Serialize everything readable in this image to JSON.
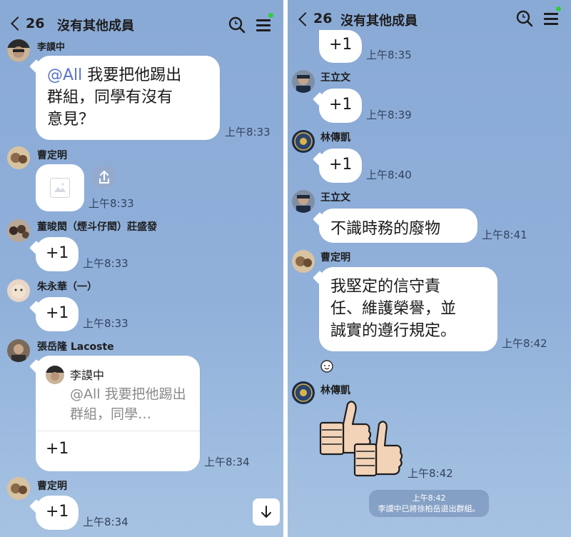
{
  "left_panel": {
    "header": {
      "member_count": "26",
      "title": "沒有其他成員"
    },
    "messages": [
      {
        "sender": "李謨中",
        "lines": [
          "@All 我要把他踢出",
          "群組，同學有沒有",
          "意見？"
        ],
        "mention": "@All",
        "time": "上午8:33"
      },
      {
        "sender": "曹定明",
        "type": "image",
        "time": "上午8:33"
      },
      {
        "sender": "董晙閎（煙斗仔閎）莊盛發",
        "text": "+1",
        "time": "上午8:33"
      },
      {
        "sender": "朱永華（一）",
        "text": "+1",
        "time": "上午8:33"
      },
      {
        "sender": "張岳隆 Lacoste",
        "quote": {
          "name": "李謨中",
          "text": "@All 我要把他踢出群組，同學…"
        },
        "text": "+1",
        "time": "上午8:34"
      },
      {
        "sender": "曹定明",
        "text": "+1",
        "time": "上午8:34"
      }
    ]
  },
  "right_panel": {
    "header": {
      "member_count": "26",
      "title": "沒有其他成員"
    },
    "messages": [
      {
        "sender": "",
        "text": "+1",
        "time": "上午8:35"
      },
      {
        "sender": "王立文",
        "text": "+1",
        "time": "上午8:39"
      },
      {
        "sender": "林傳凱",
        "text": "+1",
        "time": "上午8:40"
      },
      {
        "sender": "王立文",
        "text": "不識時務的廢物",
        "time": "上午8:41"
      },
      {
        "sender": "曹定明",
        "lines": [
          "我堅定的信守責",
          "任、維護榮譽，並",
          "誠實的遵行規定。"
        ],
        "time": "上午8:42"
      },
      {
        "sender": "林傳凱",
        "type": "sticker",
        "sticker": "double-thumbs-up",
        "time": "上午8:42"
      }
    ],
    "system_message": {
      "time": "上午8:42",
      "text": "李謨中已將徐柏岳退出群組。"
    }
  },
  "colors": {
    "chat_background": "#8aaad6",
    "mention": "#5773c8",
    "online_dot": "#2ecc40",
    "bubble": "#ffffff"
  },
  "icons": {
    "back": "chevron-left-icon",
    "search": "search-icon",
    "menu": "hamburger-menu-icon",
    "share": "share-icon",
    "scroll": "arrow-down-icon",
    "image": "image-placeholder-icon"
  }
}
